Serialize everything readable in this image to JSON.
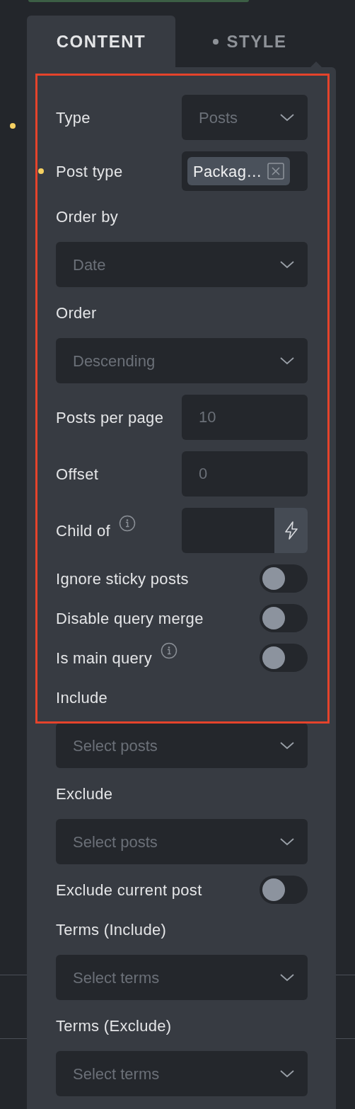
{
  "tabs": [
    {
      "label": "CONTENT",
      "selected": true,
      "modified": false
    },
    {
      "label": "STYLE",
      "selected": false,
      "modified": true
    }
  ],
  "fields": [
    {
      "kind": "select_inline",
      "label": "Type",
      "value": "Posts",
      "modified": false
    },
    {
      "kind": "tags_inline",
      "label": "Post type",
      "tags": [
        "Packag…"
      ],
      "modified": true
    },
    {
      "kind": "heading",
      "label": "Order by",
      "modified": false
    },
    {
      "kind": "select_full",
      "value": "Date",
      "modified": false
    },
    {
      "kind": "heading",
      "label": "Order",
      "modified": false
    },
    {
      "kind": "select_full",
      "value": "Descending",
      "modified": false
    },
    {
      "kind": "number_inline",
      "label": "Posts per page",
      "placeholder": "10",
      "modified": false
    },
    {
      "kind": "number_inline",
      "label": "Offset",
      "placeholder": "0",
      "modified": false
    },
    {
      "kind": "dynamic_inline",
      "label": "Child of",
      "info": true,
      "modified": false
    },
    {
      "kind": "toggle",
      "label": "Ignore sticky posts",
      "on": false,
      "info": false,
      "modified": false
    },
    {
      "kind": "toggle",
      "label": "Disable query merge",
      "on": false,
      "info": false,
      "modified": false
    },
    {
      "kind": "toggle",
      "label": "Is main query",
      "on": false,
      "info": true,
      "modified": false
    },
    {
      "kind": "heading",
      "label": "Include",
      "modified": false
    },
    {
      "kind": "select_full",
      "placeholder": "Select posts",
      "modified": false
    },
    {
      "kind": "heading",
      "label": "Exclude",
      "modified": false
    },
    {
      "kind": "select_full",
      "placeholder": "Select posts",
      "modified": false
    },
    {
      "kind": "toggle",
      "label": "Exclude current post",
      "on": false,
      "info": false,
      "modified": false
    },
    {
      "kind": "heading",
      "label": "Terms (Include)",
      "modified": false
    },
    {
      "kind": "select_full",
      "placeholder": "Select terms",
      "modified": false
    },
    {
      "kind": "heading",
      "label": "Terms (Exclude)",
      "modified": false
    },
    {
      "kind": "select_full",
      "placeholder": "Select terms",
      "modified": false
    }
  ]
}
